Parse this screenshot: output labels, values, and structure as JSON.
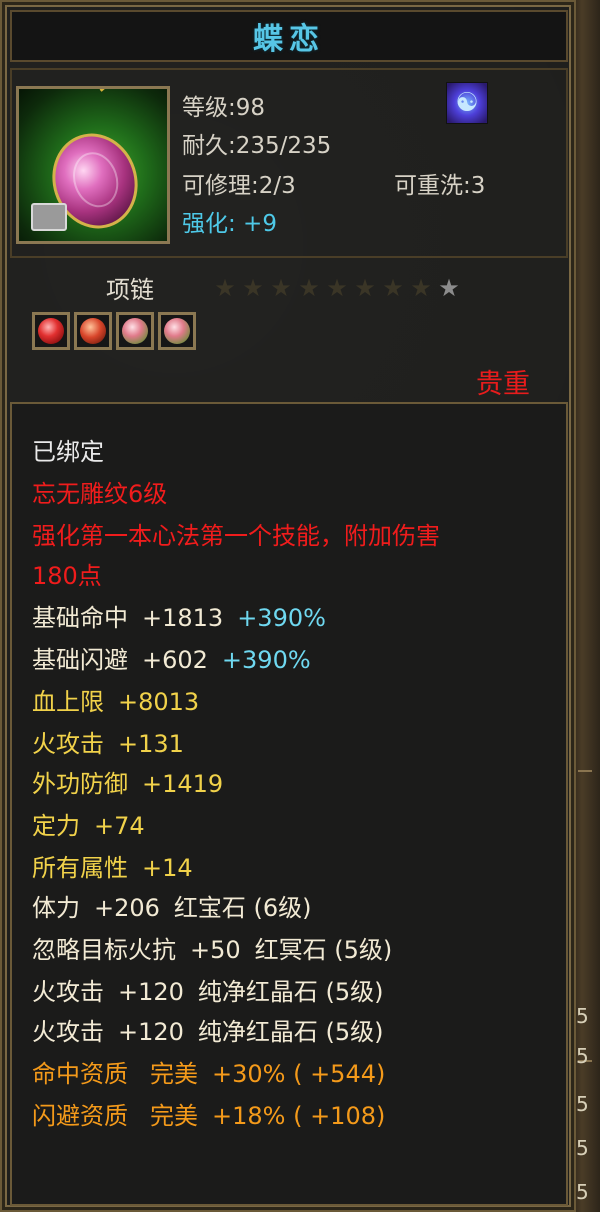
{
  "item": {
    "name": "蝶恋",
    "level_label": "等级:98",
    "durability_label": "耐久:235/235",
    "repairable_label": "可修理:2/3",
    "rewashable_label": "可重洗:3",
    "enhance_label": "强化: +9",
    "type": "项链",
    "stars_total": 9,
    "stars_lit": 1,
    "sockets": [
      "ruby",
      "red",
      "crystal",
      "crystal"
    ],
    "rarity": "贵重"
  },
  "attributes": {
    "bound": "已绑定",
    "engrave": "忘无雕纹6级",
    "engrave_desc_line1": "强化第一本心法第一个技能，附加伤害",
    "engrave_desc_line2": "180点",
    "hit_label": "基础命中",
    "hit_value": "+1813",
    "hit_bonus": "+390%",
    "dodge_label": "基础闪避",
    "dodge_value": "+602",
    "dodge_bonus": "+390%",
    "hp_label": "血上限",
    "hp_value": "+8013",
    "fire_atk_label": "火攻击",
    "fire_atk_value": "+131",
    "ext_def_label": "外功防御",
    "ext_def_value": "+1419",
    "focus_label": "定力",
    "focus_value": "+74",
    "all_attr_label": "所有属性",
    "all_attr_value": "+14",
    "gem1_stat": "体力",
    "gem1_value": "+206",
    "gem1_name": "红宝石 (6级)",
    "gem2_stat": "忽略目标火抗",
    "gem2_value": "+50",
    "gem2_name": "红冥石 (5级)",
    "gem3_stat": "火攻击",
    "gem3_value": "+120",
    "gem3_name": "纯净红晶石 (5级)",
    "gem4_stat": "火攻击",
    "gem4_value": "+120",
    "gem4_name": "纯净红晶石 (5级)",
    "apt1_label": "命中资质",
    "apt1_grade": "完美",
    "apt1_value": "+30% ( +544)",
    "apt2_label": "闪避资质",
    "apt2_grade": "完美",
    "apt2_value": "+18% ( +108)"
  },
  "background_digits": [
    "5",
    "5",
    "5",
    "5",
    "5"
  ],
  "colors": {
    "title": "#57c6e6",
    "enhance": "#4ec9e8",
    "rarity": "#e81c1c",
    "engrave": "#f01c1c",
    "base_stat": "#f2ead4",
    "extra_stat": "#f1d24a",
    "aptitude": "#f49a1a"
  }
}
